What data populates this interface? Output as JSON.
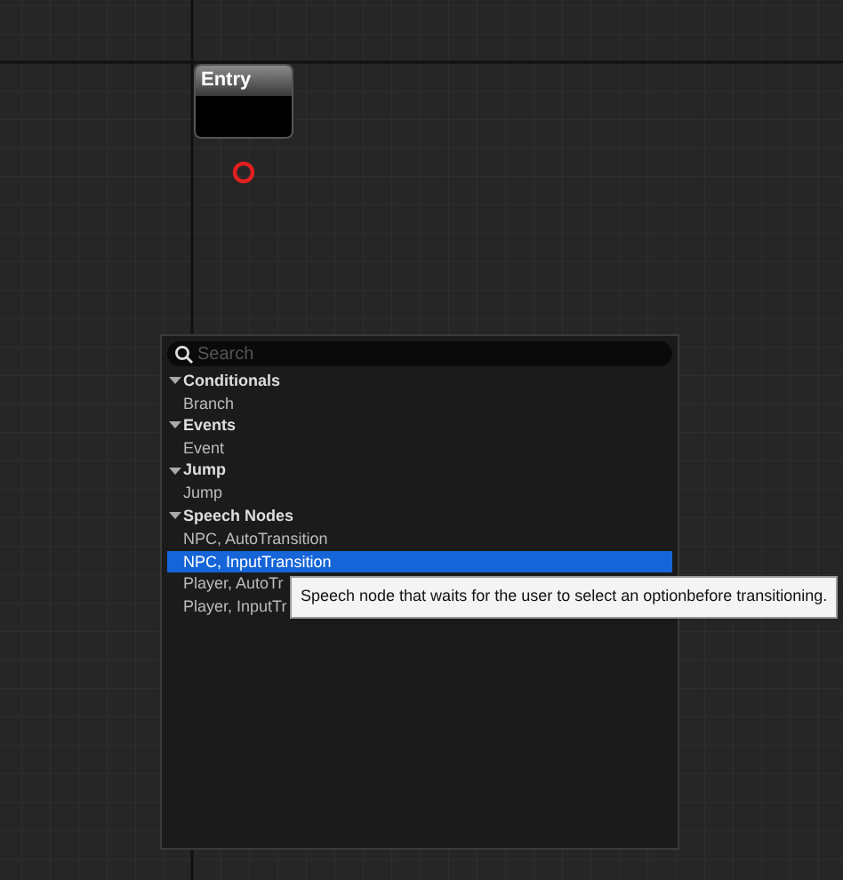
{
  "graph": {
    "nodes": [
      {
        "title": "Entry"
      }
    ]
  },
  "context_menu": {
    "search": {
      "placeholder": "Search"
    },
    "categories": [
      {
        "label": "Conditionals",
        "expanded": true,
        "children": [
          {
            "label": "Branch",
            "selected": false
          }
        ]
      },
      {
        "label": "Events",
        "expanded": true,
        "children": [
          {
            "label": "Event",
            "selected": false
          }
        ]
      },
      {
        "label": "Jump",
        "expanded": true,
        "children": [
          {
            "label": "Jump",
            "selected": false
          }
        ]
      },
      {
        "label": "Speech Nodes",
        "expanded": true,
        "children": [
          {
            "label": "NPC, AutoTransition",
            "selected": false
          },
          {
            "label": "NPC, InputTransition",
            "selected": true
          },
          {
            "label": "Player, AutoTr",
            "selected": false
          },
          {
            "label": "Player, InputTr",
            "selected": false
          }
        ]
      }
    ],
    "tooltip": "Speech node that waits for the user to select an optionbefore transitioning."
  }
}
